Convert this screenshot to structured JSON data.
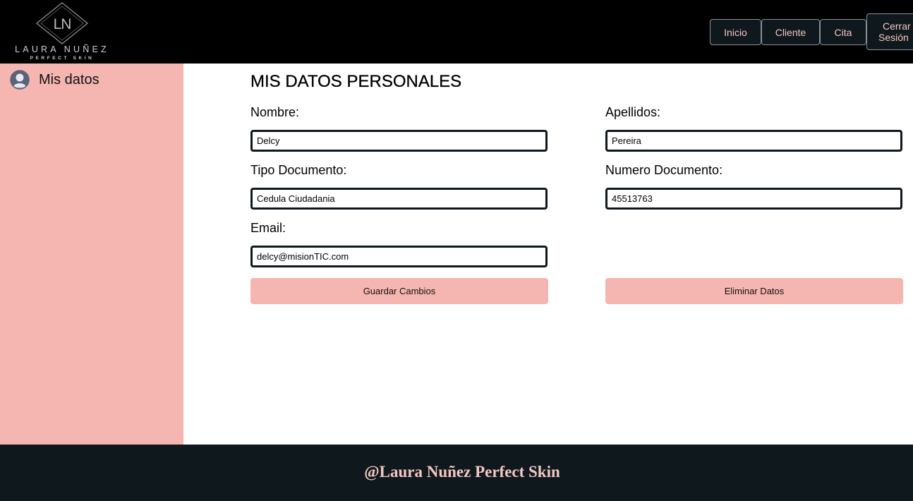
{
  "brand": {
    "monogram": "LN",
    "name": "LAURA NUÑEZ",
    "tagline": "PERFECT SKIN"
  },
  "nav": {
    "items": [
      {
        "label": "Inicio"
      },
      {
        "label": "Cliente"
      },
      {
        "label": "Cita"
      },
      {
        "label_line1": "Cerrar",
        "label_line2": "Sesión"
      }
    ]
  },
  "sidebar": {
    "items": [
      {
        "label": "Mis datos",
        "icon": "user-avatar-icon"
      }
    ]
  },
  "main": {
    "title": "MIS DATOS PERSONALES",
    "fields": {
      "nombre": {
        "label": "Nombre:",
        "value": "Delcy"
      },
      "apellidos": {
        "label": "Apellidos:",
        "value": "Pereira"
      },
      "tipo_documento": {
        "label": "Tipo Documento:",
        "value": "Cedula Ciudadania"
      },
      "numero_documento": {
        "label": "Numero Documento:",
        "value": "45513763"
      },
      "email": {
        "label": "Email:",
        "value": "delcy@misionTIC.com"
      }
    },
    "buttons": {
      "save": "Guardar Cambios",
      "delete": "Eliminar Datos"
    }
  },
  "footer": {
    "text": "@Laura Nuñez Perfect Skin"
  },
  "colors": {
    "header_bg": "#000000",
    "accent_pink": "#f5b5b0",
    "dark": "#0f181d",
    "nav_text": "#f3c7c2"
  }
}
